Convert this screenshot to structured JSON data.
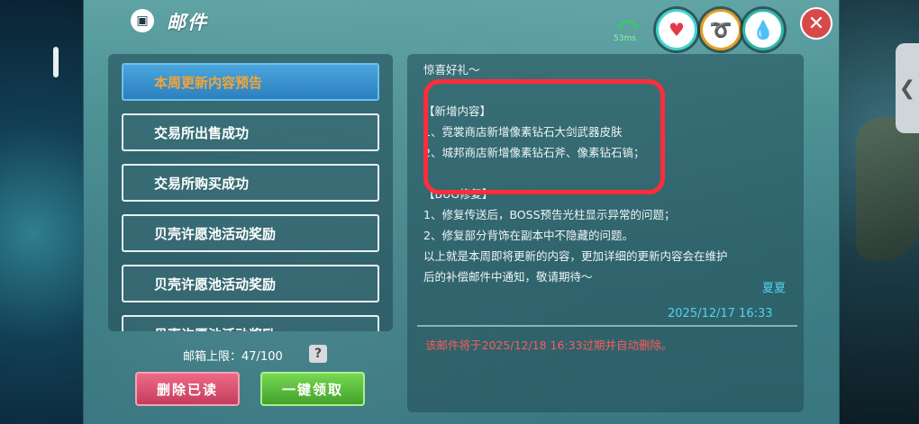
{
  "header": {
    "title": "邮件",
    "title_icon": "mailbox-icon"
  },
  "status": {
    "ping": "53ms"
  },
  "close_label": "✕",
  "mail_list": [
    {
      "label": "本周更新内容预告",
      "active": true
    },
    {
      "label": "交易所出售成功",
      "active": false
    },
    {
      "label": "交易所购买成功",
      "active": false
    },
    {
      "label": "贝壳许愿池活动奖励",
      "active": false
    },
    {
      "label": "贝壳许愿池活动奖励",
      "active": false
    },
    {
      "label": "贝壳许愿池活动奖励",
      "active": false
    }
  ],
  "capacity": "邮箱上限：47/100",
  "help_label": "?",
  "buttons": {
    "delete_read": "删除已读",
    "claim_all": "一键领取"
  },
  "content": {
    "lines": [
      "惊喜好礼～",
      "",
      "【新增内容】",
      "1、霓裳商店新增像素钻石大剑武器皮肤",
      "2、城邦商店新增像素钻石斧、像素钻石镐；",
      "",
      "【BUG修复】",
      "1、修复传送后，BOSS预告光柱显示异常的问题；",
      "2、修复部分背饰在副本中不隐藏的问题。",
      "",
      "以上就是本周即将更新的内容，更加详细的更新内容会在维护",
      "后的补偿邮件中通知，敬请期待～"
    ],
    "sender": "夏夏",
    "date": "2025/12/17 16:33",
    "expire_notice": "该邮件将于2025/12/18 16:33过期并自动删除。"
  },
  "colors": {
    "accent_active": "#f2a43a",
    "highlight": "#ff2d3a",
    "date": "#56d0e8",
    "expire": "#ff5a5a"
  }
}
